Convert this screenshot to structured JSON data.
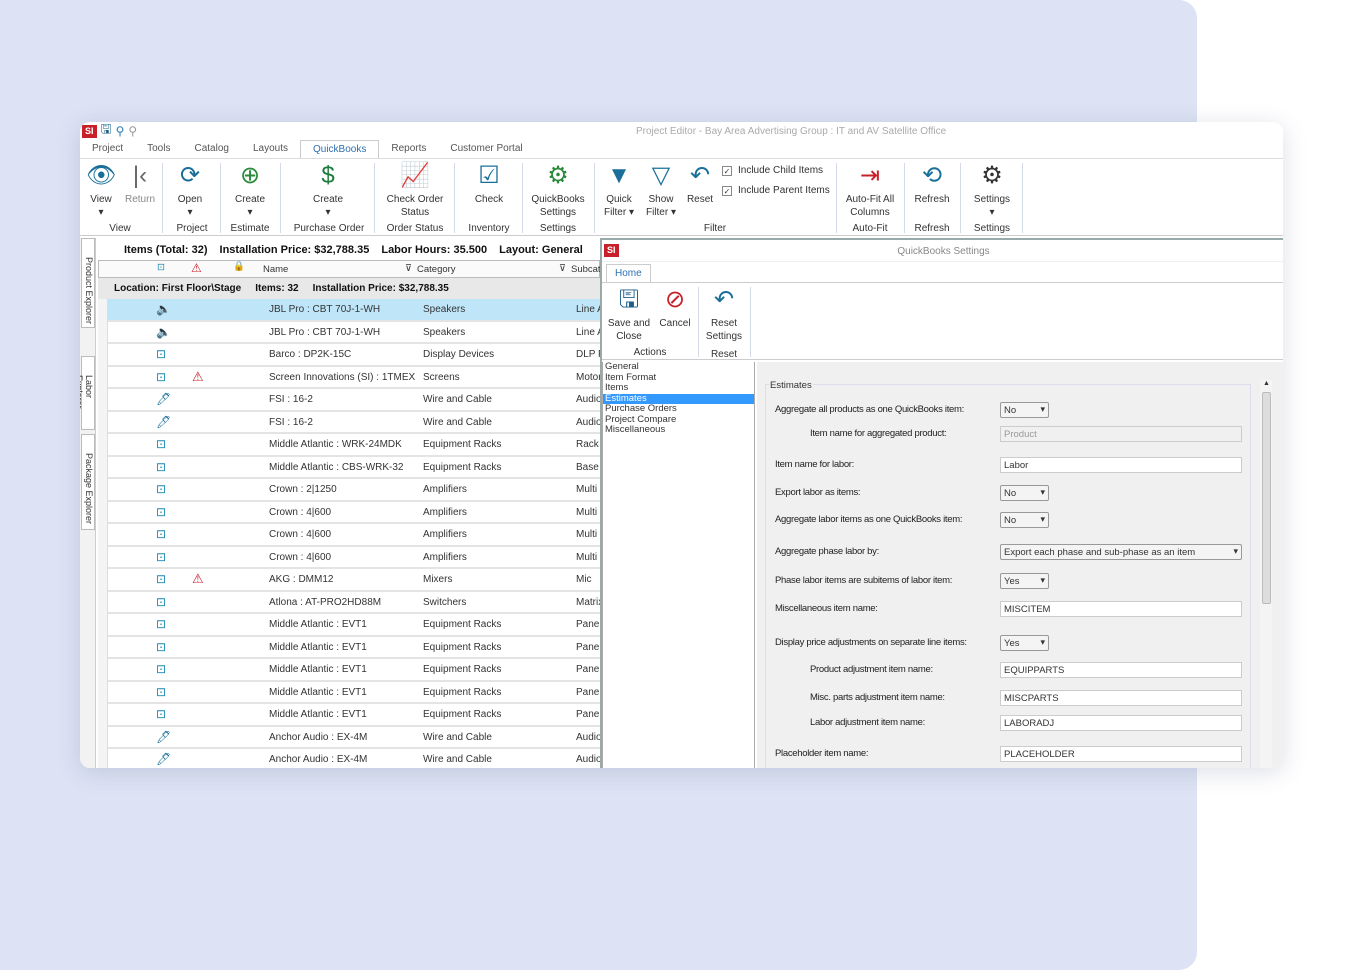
{
  "window": {
    "title": "Project Editor - Bay Area Advertising Group : IT and AV Satellite Office",
    "logo": "SI"
  },
  "tabs": [
    "Project",
    "Tools",
    "Catalog",
    "Layouts",
    "QuickBooks",
    "Reports",
    "Customer Portal"
  ],
  "active_tab": "QuickBooks",
  "ribbon": {
    "buttons": {
      "view": "View",
      "return": "Return",
      "open": "Open",
      "create_estimate": "Create",
      "create_po": "Create",
      "check_order": "Check Order Status",
      "check_inv": "Check",
      "qb_settings": "QuickBooks Settings",
      "quick_filter": "Quick Filter",
      "show_filter": "Show Filter",
      "reset": "Reset",
      "autofit": "Auto-Fit All Columns",
      "refresh": "Refresh",
      "settings": "Settings"
    },
    "checks": {
      "child": "Include Child Items",
      "parent": "Include Parent Items"
    },
    "groups": {
      "view": "View",
      "project": "Project",
      "estimate": "Estimate",
      "po": "Purchase Order",
      "order": "Order Status",
      "inventory": "Inventory",
      "settings1": "Settings",
      "filter": "Filter",
      "autofit": "Auto-Fit",
      "refresh": "Refresh",
      "settings2": "Settings"
    }
  },
  "side_tabs": [
    "Product Explorer",
    "Labor Explorer",
    "Package Explorer"
  ],
  "summary": {
    "items": "Items (Total: 32)",
    "price": "Installation Price: $32,788.35",
    "hours": "Labor Hours: 35.500",
    "layout": "Layout: General"
  },
  "columns": {
    "name": "Name",
    "category": "Category",
    "subcat": "Subcat"
  },
  "location": {
    "label": "Location: First Floor\\Stage",
    "items": "Items: 32",
    "price": "Installation Price: $32,788.35"
  },
  "rows": [
    {
      "icon": "speaker",
      "warn": false,
      "name": "JBL Pro : CBT 70J-1-WH",
      "cat": "Speakers",
      "sub": "Line A",
      "selected": true
    },
    {
      "icon": "speaker",
      "warn": false,
      "name": "JBL Pro : CBT 70J-1-WH",
      "cat": "Speakers",
      "sub": "Line A"
    },
    {
      "icon": "box",
      "warn": false,
      "name": "Barco : DP2K-15C",
      "cat": "Display Devices",
      "sub": "DLP P"
    },
    {
      "icon": "box",
      "warn": true,
      "name": "Screen Innovations (SI) : 1TMEX",
      "cat": "Screens",
      "sub": "Motor"
    },
    {
      "icon": "cable",
      "warn": false,
      "name": "FSI : 16-2",
      "cat": "Wire and Cable",
      "sub": "Audio"
    },
    {
      "icon": "cable",
      "warn": false,
      "name": "FSI : 16-2",
      "cat": "Wire and Cable",
      "sub": "Audio"
    },
    {
      "icon": "box",
      "warn": false,
      "name": "Middle Atlantic : WRK-24MDK",
      "cat": "Equipment Racks",
      "sub": "Rack"
    },
    {
      "icon": "box",
      "warn": false,
      "name": "Middle Atlantic : CBS-WRK-32",
      "cat": "Equipment Racks",
      "sub": "Base"
    },
    {
      "icon": "box",
      "warn": false,
      "name": "Crown : 2|1250",
      "cat": "Amplifiers",
      "sub": "Multi"
    },
    {
      "icon": "box",
      "warn": false,
      "name": "Crown : 4|600",
      "cat": "Amplifiers",
      "sub": "Multi"
    },
    {
      "icon": "box",
      "warn": false,
      "name": "Crown : 4|600",
      "cat": "Amplifiers",
      "sub": "Multi"
    },
    {
      "icon": "box",
      "warn": false,
      "name": "Crown : 4|600",
      "cat": "Amplifiers",
      "sub": "Multi"
    },
    {
      "icon": "box",
      "warn": true,
      "name": "AKG : DMM12",
      "cat": "Mixers",
      "sub": "Mic"
    },
    {
      "icon": "box",
      "warn": false,
      "name": "Atlona : AT-PRO2HD88M",
      "cat": "Switchers",
      "sub": "Matrix"
    },
    {
      "icon": "box",
      "warn": false,
      "name": "Middle Atlantic : EVT1",
      "cat": "Equipment Racks",
      "sub": "Panel"
    },
    {
      "icon": "box",
      "warn": false,
      "name": "Middle Atlantic : EVT1",
      "cat": "Equipment Racks",
      "sub": "Panel"
    },
    {
      "icon": "box",
      "warn": false,
      "name": "Middle Atlantic : EVT1",
      "cat": "Equipment Racks",
      "sub": "Panel"
    },
    {
      "icon": "box",
      "warn": false,
      "name": "Middle Atlantic : EVT1",
      "cat": "Equipment Racks",
      "sub": "Panel"
    },
    {
      "icon": "box",
      "warn": false,
      "name": "Middle Atlantic : EVT1",
      "cat": "Equipment Racks",
      "sub": "Panel"
    },
    {
      "icon": "cable",
      "warn": false,
      "name": "Anchor Audio : EX-4M",
      "cat": "Wire and Cable",
      "sub": "Audio"
    },
    {
      "icon": "cable",
      "warn": false,
      "name": "Anchor Audio : EX-4M",
      "cat": "Wire and Cable",
      "sub": "Audio"
    }
  ],
  "dialog": {
    "title": "QuickBooks Settings",
    "logo": "SI",
    "tab": "Home",
    "buttons": {
      "save": "Save and Close",
      "cancel": "Cancel",
      "reset": "Reset Settings"
    },
    "groups": {
      "actions": "Actions",
      "reset": "Reset"
    },
    "nav": [
      "General",
      "Item Format",
      "Items",
      "Estimates",
      "Purchase Orders",
      "Project Compare",
      "Miscellaneous"
    ],
    "nav_selected": "Estimates",
    "section": "Estimates",
    "fields": [
      {
        "label": "Aggregate all products as one QuickBooks item:",
        "type": "select",
        "value": "No"
      },
      {
        "label": "Item name for aggregated product:",
        "type": "input",
        "value": "Product",
        "indent": true,
        "disabled": true
      },
      {
        "label": "Item name for labor:",
        "type": "input",
        "value": "Labor"
      },
      {
        "label": "Export labor as items:",
        "type": "select",
        "value": "No"
      },
      {
        "label": "Aggregate labor items as one QuickBooks item:",
        "type": "select",
        "value": "No"
      },
      {
        "label": "Aggregate phase labor by:",
        "type": "wideselect",
        "value": "Export each phase and sub-phase as an item"
      },
      {
        "label": "Phase labor items are subitems of labor item:",
        "type": "select",
        "value": "Yes"
      },
      {
        "label": "Miscellaneous item name:",
        "type": "input",
        "value": "MISCITEM"
      },
      {
        "label": "Display price adjustments on separate line items:",
        "type": "select",
        "value": "Yes"
      },
      {
        "label": "Product adjustment item name:",
        "type": "input",
        "value": "EQUIPPARTS",
        "indent": true
      },
      {
        "label": "Misc. parts adjustment item name:",
        "type": "input",
        "value": "MISCPARTS",
        "indent": true
      },
      {
        "label": "Labor adjustment item name:",
        "type": "input",
        "value": "LABORADJ",
        "indent": true
      },
      {
        "label": "Placeholder item name:",
        "type": "input",
        "value": "PLACEHOLDER"
      }
    ]
  },
  "colors": {
    "accent": "#2f6fb0",
    "selection": "#bfe6f8",
    "nav_selected": "#3399ff",
    "warn": "#c8202a",
    "icon_teal": "#1a6f9a"
  }
}
